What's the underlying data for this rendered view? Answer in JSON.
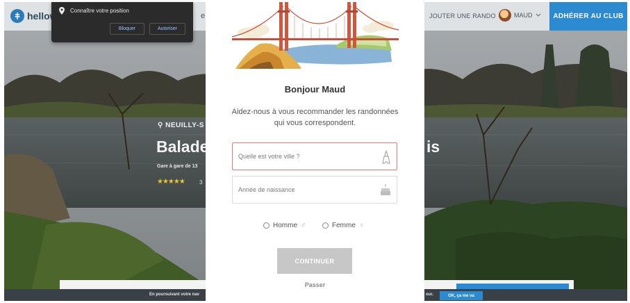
{
  "site": {
    "logo_text": "hellow",
    "nav_fragment": "e »",
    "nav_add": "JOUTER UNE RANDO",
    "user_name": "MAUD",
    "join_label": "ADHÉRER AU CLUB"
  },
  "permission": {
    "message": "Connaître votre position",
    "block_label": "Bloquer",
    "allow_label": "Autoriser"
  },
  "page": {
    "location": "NEUILLY-S",
    "title_left": "Balade",
    "title_right": "is",
    "subtitle": "Gare à gare de 13",
    "stars": "★★★★★",
    "rating_count": "3",
    "cookie_text": "En poursuivant votre nav",
    "cookie_suffix": "our.",
    "cookie_ok": "OK, ça me va"
  },
  "modal": {
    "greeting": "Bonjour Maud",
    "helper_line1": "Aidez-nous à vous recommander les randonnées",
    "helper_line2": "qui vous correspondent.",
    "city_placeholder": "Quelle est votre ville ?",
    "birth_placeholder": "Année de naissance",
    "gender_male": "Homme",
    "gender_female": "Femme",
    "male_symbol": "♂",
    "female_symbol": "♀",
    "continue_label": "CONTINUER",
    "skip_label": "Passer"
  },
  "colors": {
    "accent": "#2c8ad0",
    "error_border": "#e07c71",
    "disabled_button": "#c7c7c7"
  },
  "icons": [
    "location-pin-icon",
    "eiffel-tower-icon",
    "birthday-cake-icon",
    "chevron-down-icon",
    "logo-icon"
  ]
}
